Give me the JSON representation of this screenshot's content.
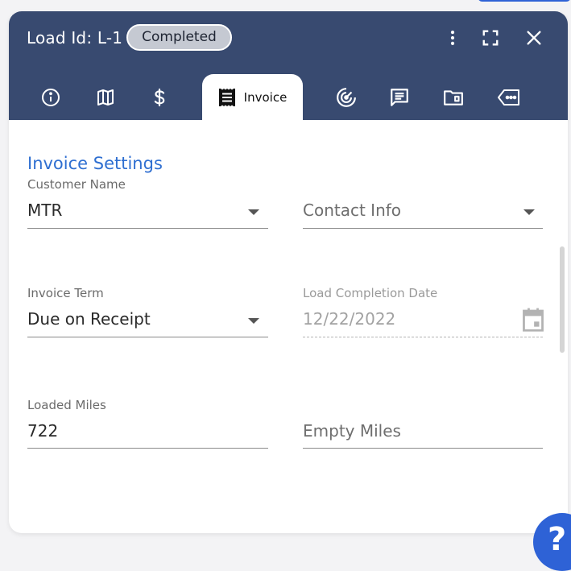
{
  "header": {
    "title": "Load Id: L-1",
    "status": "Completed",
    "active_tab_label": "Invoice"
  },
  "tabs": [
    {
      "name": "info",
      "icon": "info-icon"
    },
    {
      "name": "map",
      "icon": "map-icon"
    },
    {
      "name": "financials",
      "icon": "dollar-icon"
    },
    {
      "name": "invoice",
      "icon": "receipt-icon",
      "label": "Invoice"
    },
    {
      "name": "tracking",
      "icon": "radar-icon"
    },
    {
      "name": "notes",
      "icon": "notes-icon"
    },
    {
      "name": "documents",
      "icon": "folder-icon"
    },
    {
      "name": "tags",
      "icon": "tag-icon"
    }
  ],
  "section": {
    "title": "Invoice Settings"
  },
  "fields": {
    "customer_name": {
      "label": "Customer Name",
      "value": "MTR"
    },
    "contact_info": {
      "placeholder": "Contact Info"
    },
    "invoice_term": {
      "label": "Invoice Term",
      "value": "Due on Receipt"
    },
    "load_completion_date": {
      "label": "Load Completion Date",
      "value": "12/22/2022"
    },
    "loaded_miles": {
      "label": "Loaded Miles",
      "value": "722"
    },
    "empty_miles": {
      "placeholder": "Empty Miles"
    }
  },
  "colors": {
    "header_bg": "#384a70",
    "accent": "#2f6fd1",
    "fab": "#2e62d6"
  }
}
